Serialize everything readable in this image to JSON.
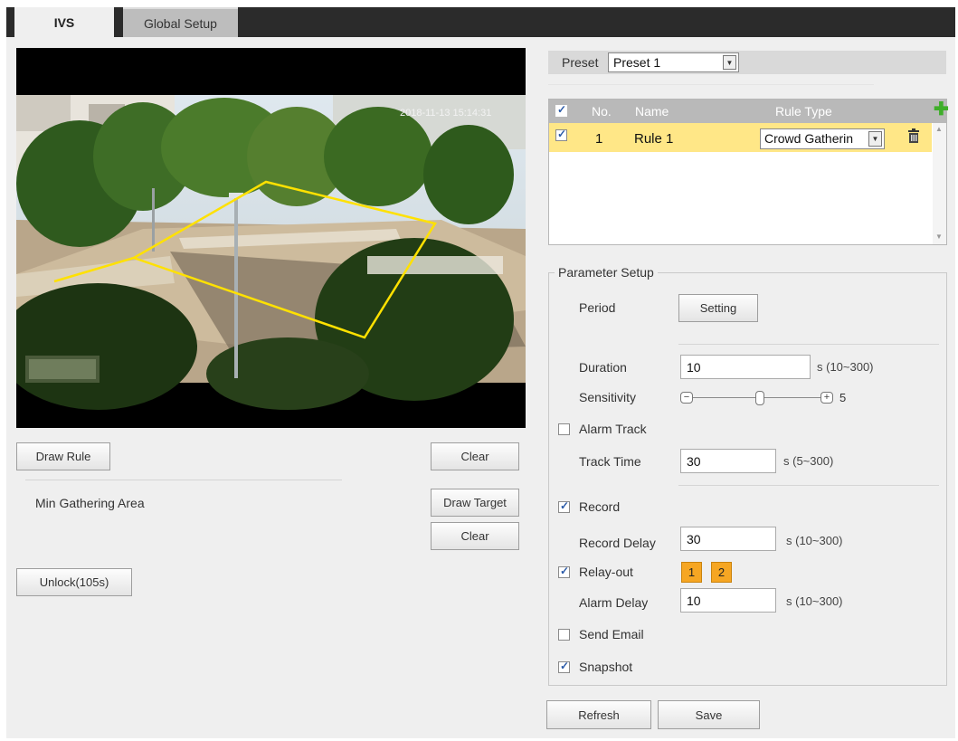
{
  "tabs": [
    {
      "label": "IVS",
      "active": true
    },
    {
      "label": "Global Setup",
      "active": false
    }
  ],
  "video": {
    "timestamp": "2018-11-13 15:14:31"
  },
  "left": {
    "draw_rule_label": "Draw Rule",
    "clear_label": "Clear",
    "min_area_label": "Min Gathering Area",
    "draw_target_label": "Draw Target",
    "clear2_label": "Clear",
    "unlock_label": "Unlock(105s)"
  },
  "preset": {
    "label": "Preset",
    "value": "Preset 1"
  },
  "rules_table": {
    "headers": {
      "no": "No.",
      "name": "Name",
      "rule_type": "Rule Type"
    },
    "rows": [
      {
        "checked": true,
        "no": "1",
        "name": "Rule 1",
        "rule_type": "Crowd Gatherin"
      }
    ]
  },
  "params": {
    "legend": "Parameter Setup",
    "period_label": "Period",
    "setting_label": "Setting",
    "duration_label": "Duration",
    "duration_value": "10",
    "duration_hint": "s (10~300)",
    "sensitivity_label": "Sensitivity",
    "sensitivity_value": "5",
    "sensitivity_level": 0.5,
    "alarm_track_label": "Alarm Track",
    "alarm_track_checked": false,
    "track_time_label": "Track Time",
    "track_time_value": "30",
    "track_time_hint": "s (5~300)",
    "record_label": "Record",
    "record_checked": true,
    "record_delay_label": "Record Delay",
    "record_delay_value": "30",
    "record_delay_hint": "s (10~300)",
    "relay_label": "Relay-out",
    "relay_checked": true,
    "relay_channels": [
      "1",
      "2"
    ],
    "alarm_delay_label": "Alarm Delay",
    "alarm_delay_value": "10",
    "alarm_delay_hint": "s (10~300)",
    "send_email_label": "Send Email",
    "send_email_checked": false,
    "snapshot_label": "Snapshot",
    "snapshot_checked": true
  },
  "footer": {
    "refresh_label": "Refresh",
    "save_label": "Save"
  },
  "colors": {
    "tab_bar": "#2b2b2b",
    "selected_row": "#ffe787",
    "header_row": "#b9b9b9",
    "relay_button": "#f6a623",
    "rule_line": "#ffe100",
    "add_icon": "#3fae2a"
  },
  "icons": [
    "add-icon",
    "delete-icon",
    "dropdown-arrow-icon",
    "minus-icon",
    "plus-icon",
    "scroll-up-icon",
    "scroll-down-icon"
  ]
}
